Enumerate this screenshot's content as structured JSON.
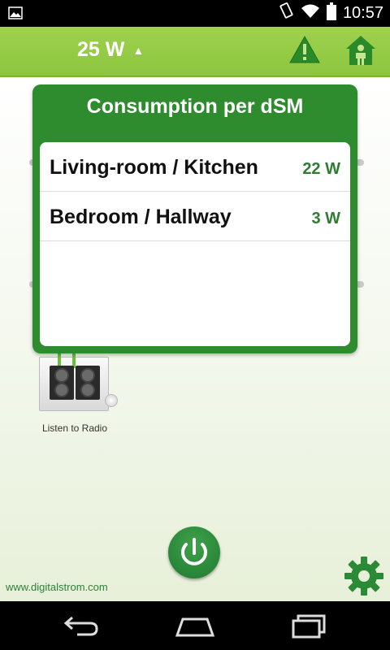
{
  "status_bar": {
    "time": "10:57",
    "icons": [
      "gallery-icon",
      "vibrate-icon",
      "wifi-icon",
      "battery-icon"
    ]
  },
  "app_bar": {
    "power_reading": "25 W",
    "buttons": [
      "warning-icon",
      "home-person-icon"
    ]
  },
  "popup": {
    "title": "Consumption per dSM",
    "rows": [
      {
        "room": "Living-room / Kitchen",
        "watts": "22 W"
      },
      {
        "room": "Bedroom / Hallway",
        "watts": "3 W"
      }
    ]
  },
  "tiles": [
    {
      "label": "Listen to Radio",
      "icon": "speakers-icon"
    }
  ],
  "footer": {
    "website": "www.digitalstrom.com"
  },
  "nav_bar": {
    "buttons": [
      "back-icon",
      "home-icon",
      "recents-icon"
    ]
  },
  "colors": {
    "app_bar": "#8cc63f",
    "popup": "#2e8b2e",
    "watts_text": "#2e7d32",
    "power_button": "#1f7a2f"
  }
}
